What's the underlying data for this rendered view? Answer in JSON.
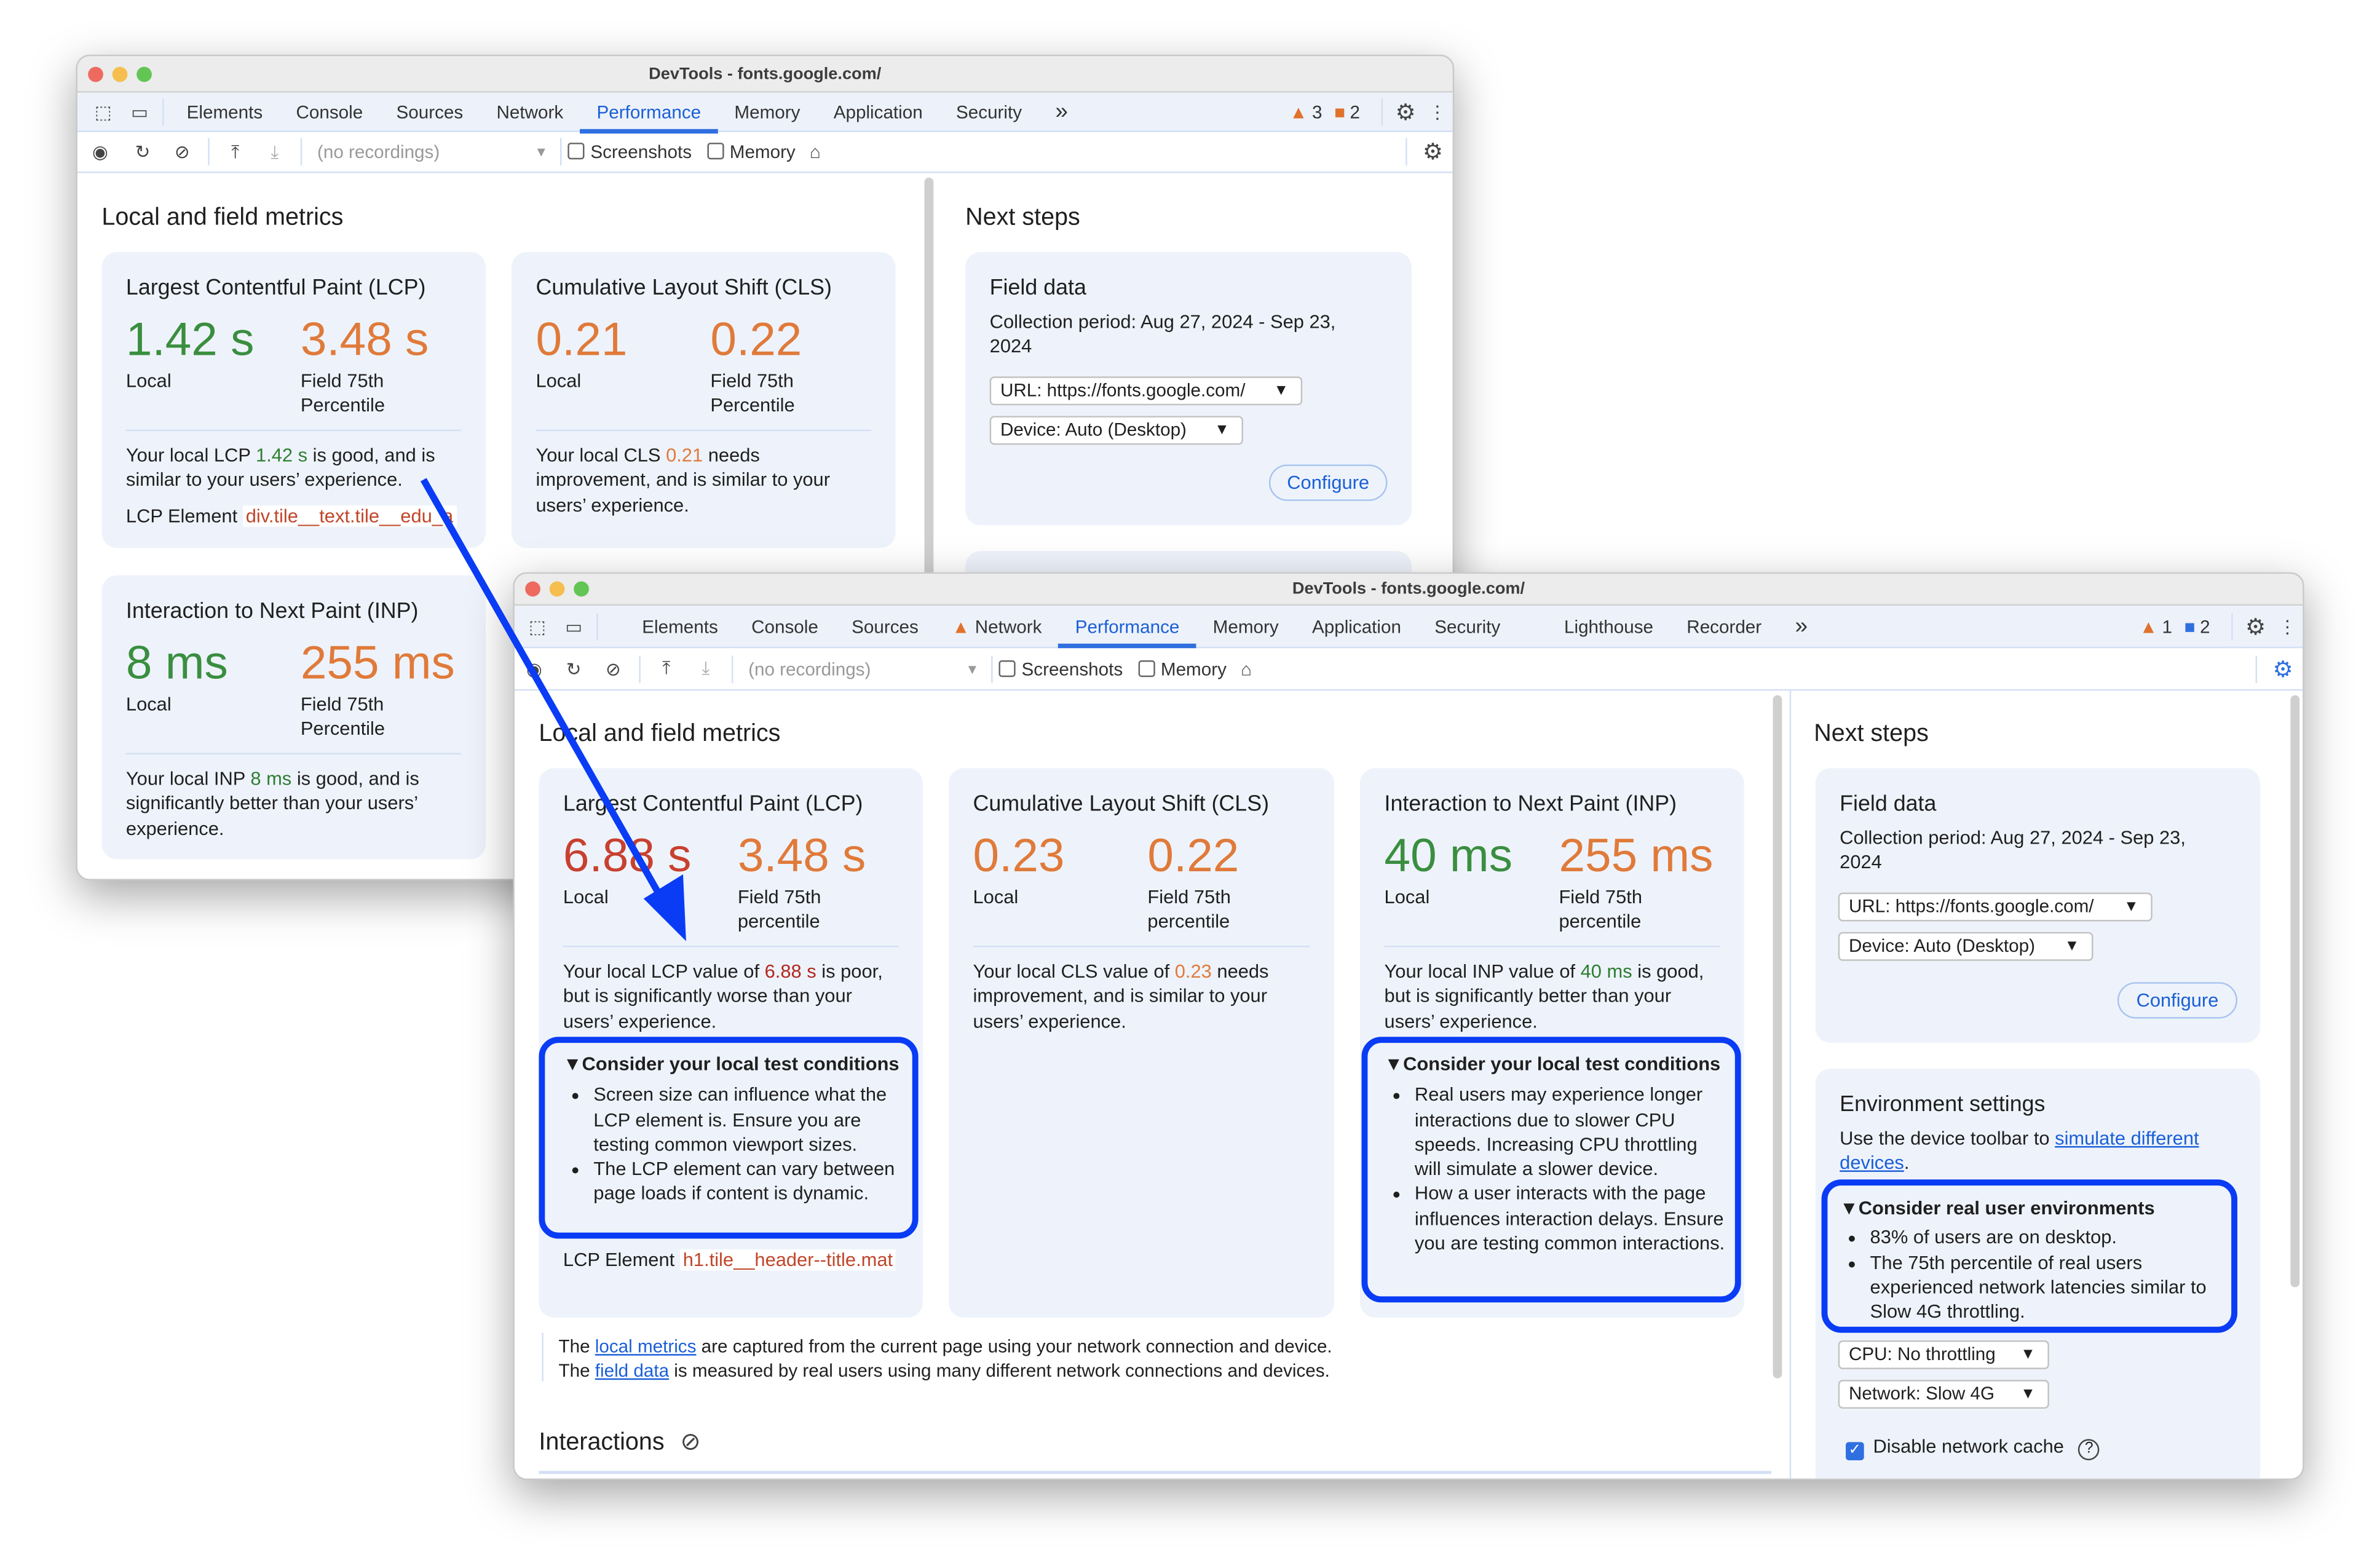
{
  "colors": {
    "accent": "#1a5fd8",
    "poor": "#c8402f",
    "needs_improvement": "#e07a3a",
    "good": "#3a8e3f",
    "annotation": "#0a3cf5"
  },
  "back_window": {
    "title": "DevTools - fonts.google.com/",
    "tabs": [
      "Elements",
      "Console",
      "Sources",
      "Network",
      "Performance",
      "Memory",
      "Application",
      "Security"
    ],
    "active_tab": "Performance",
    "more_tabs": "»",
    "warnings": "3",
    "issues": "2",
    "recordings_placeholder": "(no recordings)",
    "screenshots_label": "Screenshots",
    "memory_label": "Memory",
    "section_title": "Local and field metrics",
    "lcp": {
      "title": "Largest Contentful Paint (LCP)",
      "local": "1.42 s",
      "field": "3.48 s",
      "local_label": "Local",
      "field_label": "Field 75th Percentile",
      "desc_a": "Your local LCP ",
      "desc_val": "1.42 s",
      "desc_b": " is good, and is similar to your users’ experience.",
      "element_label": "LCP Element",
      "element_value": "div.tile__text.tile__edu_a"
    },
    "cls": {
      "title": "Cumulative Layout Shift (CLS)",
      "local": "0.21",
      "field": "0.22",
      "local_label": "Local",
      "field_label": "Field 75th Percentile",
      "desc_a": "Your local CLS ",
      "desc_val": "0.21",
      "desc_b": " needs improvement, and is similar to your users’ experience."
    },
    "inp": {
      "title": "Interaction to Next Paint (INP)",
      "local": "8 ms",
      "field": "255 ms",
      "local_label": "Local",
      "field_label": "Field 75th Percentile",
      "desc_a": "Your local INP ",
      "desc_val": "8 ms",
      "desc_b": " is good, and is significantly better than your users’ experience."
    },
    "next_steps": "Next steps",
    "field_data": {
      "title": "Field data",
      "period": "Collection period: Aug 27, 2024 - Sep 23, 2024",
      "url": "URL: https://fonts.google.com/",
      "device": "Device: Auto (Desktop)",
      "configure": "Configure"
    }
  },
  "front_window": {
    "title": "DevTools - fonts.google.com/",
    "tabs": [
      "Elements",
      "Console",
      "Sources",
      "Network",
      "Performance",
      "Memory",
      "Application",
      "Security",
      "Lighthouse",
      "Recorder"
    ],
    "active_tab": "Performance",
    "more_tabs": "»",
    "warnings": "1",
    "messages": "2",
    "recordings_placeholder": "(no recordings)",
    "screenshots_label": "Screenshots",
    "memory_label": "Memory",
    "section_title": "Local and field metrics",
    "lcp": {
      "title": "Largest Contentful Paint (LCP)",
      "local": "6.88 s",
      "field": "3.48 s",
      "local_label": "Local",
      "field_label": "Field 75th percentile",
      "desc_a": "Your local LCP value of ",
      "desc_val": "6.88 s",
      "desc_b": " is poor, but is significantly worse than your users’ experience.",
      "details_summary": "Consider your local test conditions",
      "details_items": [
        "Screen size can influence what the LCP element is. Ensure you are testing common viewport sizes.",
        "The LCP element can vary between page loads if content is dynamic."
      ],
      "element_label": "LCP Element",
      "element_value": "h1.tile__header--title.mat"
    },
    "cls": {
      "title": "Cumulative Layout Shift (CLS)",
      "local": "0.23",
      "field": "0.22",
      "local_label": "Local",
      "field_label": "Field 75th percentile",
      "desc_a": "Your local CLS value of ",
      "desc_val": "0.23",
      "desc_b": " needs improvement, and is similar to your users’ experience."
    },
    "inp": {
      "title": "Interaction to Next Paint (INP)",
      "local": "40 ms",
      "field": "255 ms",
      "local_label": "Local",
      "field_label": "Field 75th percentile",
      "desc_a": "Your local INP value of ",
      "desc_val": "40 ms",
      "desc_b": " is good, but is significantly better than your users’ experience.",
      "details_summary": "Consider your local test conditions",
      "details_items": [
        "Real users may experience longer interactions due to slower CPU speeds. Increasing CPU throttling will simulate a slower device.",
        "How a user interacts with the page influences interaction delays. Ensure you are testing common interactions."
      ]
    },
    "footer": {
      "line1_a": "The ",
      "line1_link": "local metrics",
      "line1_b": " are captured from the current page using your network connection and device.",
      "line2_a": "The ",
      "line2_link": "field data",
      "line2_b": " is measured by real users using many different network connections and devices."
    },
    "interactions_title": "Interactions",
    "next_steps": "Next steps",
    "field_data": {
      "title": "Field data",
      "period": "Collection period: Aug 27, 2024 - Sep 23, 2024",
      "url": "URL: https://fonts.google.com/",
      "device": "Device: Auto (Desktop)",
      "configure": "Configure"
    },
    "environment": {
      "title": "Environment settings",
      "desc_a": "Use the device toolbar to ",
      "desc_link": "simulate different devices",
      "desc_b": ".",
      "details_summary": "Consider real user environments",
      "details_items": [
        "83% of users are on desktop.",
        "The 75th percentile of real users experienced network latencies similar to Slow 4G throttling."
      ],
      "cpu": "CPU: No throttling",
      "network": "Network: Slow 4G",
      "disable_cache": "Disable network cache",
      "disable_cache_checked": true
    }
  }
}
